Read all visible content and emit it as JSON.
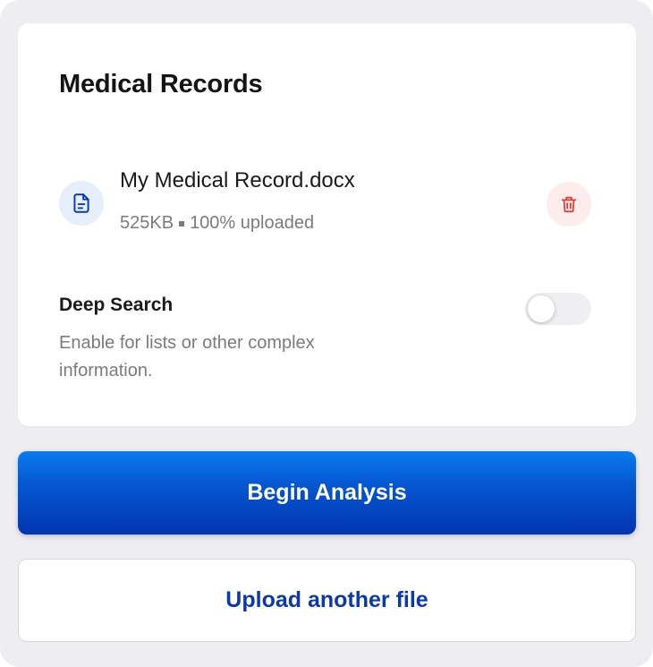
{
  "card": {
    "title": "Medical Records",
    "file": {
      "icon": "document-icon",
      "name": "My Medical Record.docx",
      "size": "525KB",
      "status": "100% uploaded",
      "delete_icon": "trash-icon"
    },
    "deep_search": {
      "label": "Deep Search",
      "description": "Enable for lists or other complex information.",
      "enabled": false
    }
  },
  "actions": {
    "primary_label": "Begin Analysis",
    "secondary_label": "Upload another file"
  },
  "colors": {
    "primary": "#0558d2",
    "link_text": "#0b3aa8",
    "danger": "#e53935",
    "icon_blue": "#0b3aa8"
  }
}
